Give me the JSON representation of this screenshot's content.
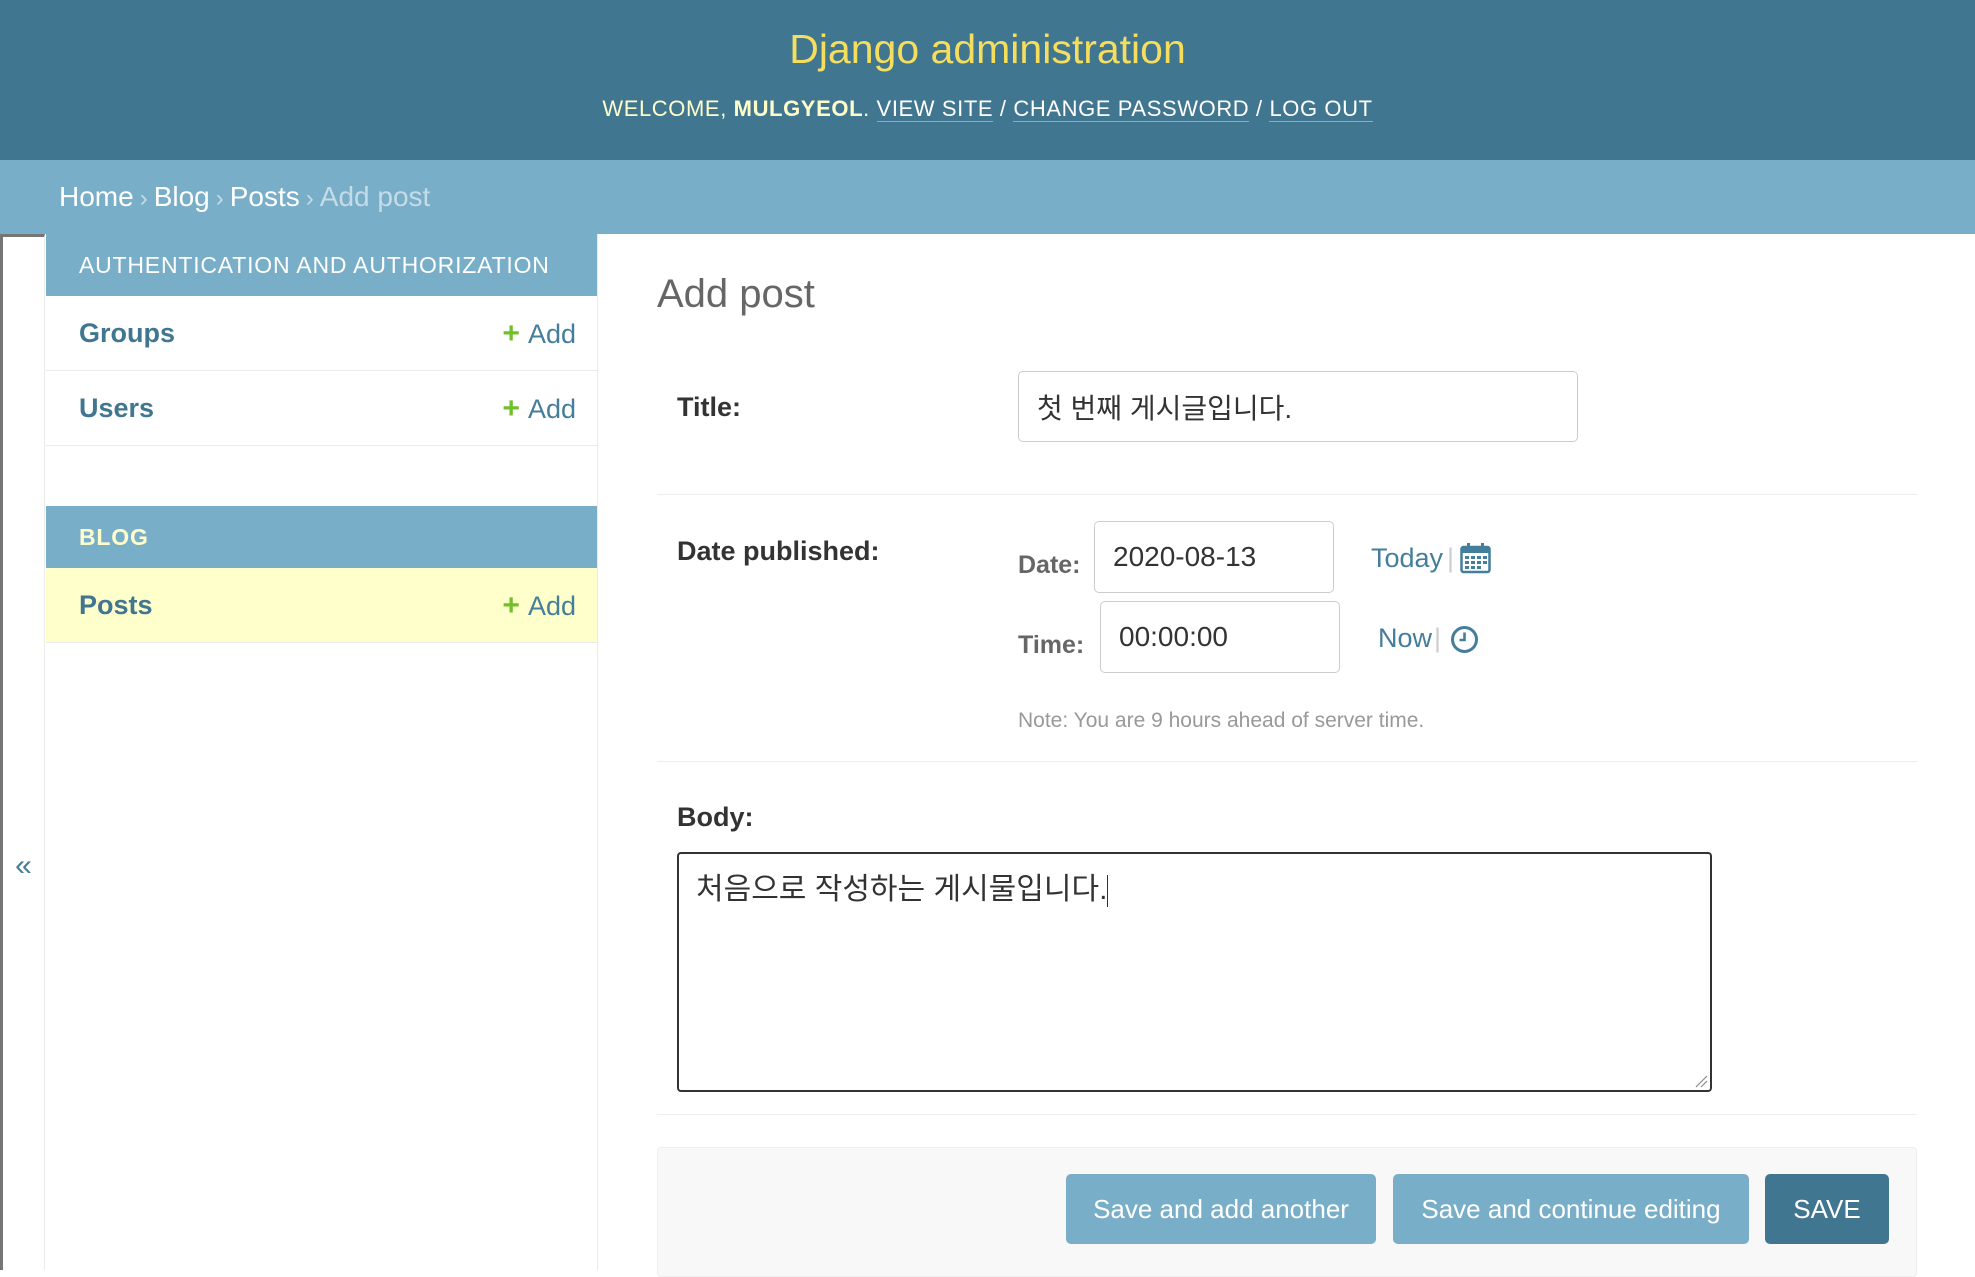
{
  "header": {
    "branding": "Django administration",
    "welcome": "Welcome,",
    "username": "mulgyeol",
    "view_site": "View site",
    "change_password": "Change password",
    "log_out": "Log out"
  },
  "breadcrumbs": {
    "home": "Home",
    "app": "Blog",
    "model": "Posts",
    "current": "Add post"
  },
  "sidebar": {
    "toggle": "«",
    "modules": [
      {
        "caption": "Authentication and Authorization",
        "models": [
          {
            "name": "Groups",
            "add": "Add"
          },
          {
            "name": "Users",
            "add": "Add"
          }
        ]
      },
      {
        "caption": "Blog",
        "models": [
          {
            "name": "Posts",
            "add": "Add"
          }
        ]
      }
    ]
  },
  "form": {
    "page_title": "Add post",
    "title_label": "Title:",
    "title_value": "첫 번째 게시글입니다.",
    "date_published_label": "Date published:",
    "date_label": "Date:",
    "date_value": "2020-08-13",
    "today": "Today",
    "time_label": "Time:",
    "time_value": "00:00:00",
    "now": "Now",
    "timezone_note": "Note: You are 9 hours ahead of server time.",
    "body_label": "Body:",
    "body_value": "처음으로 작성하는 게시물입니다."
  },
  "submit": {
    "save_add_another": "Save and add another",
    "save_continue": "Save and continue editing",
    "save": "Save"
  },
  "colors": {
    "header_bg": "#417690",
    "branding": "#f5dd5d",
    "breadcrumb_bg": "#79aec8",
    "current_row_bg": "#ffffcc",
    "add_icon": "#70bf2b"
  }
}
